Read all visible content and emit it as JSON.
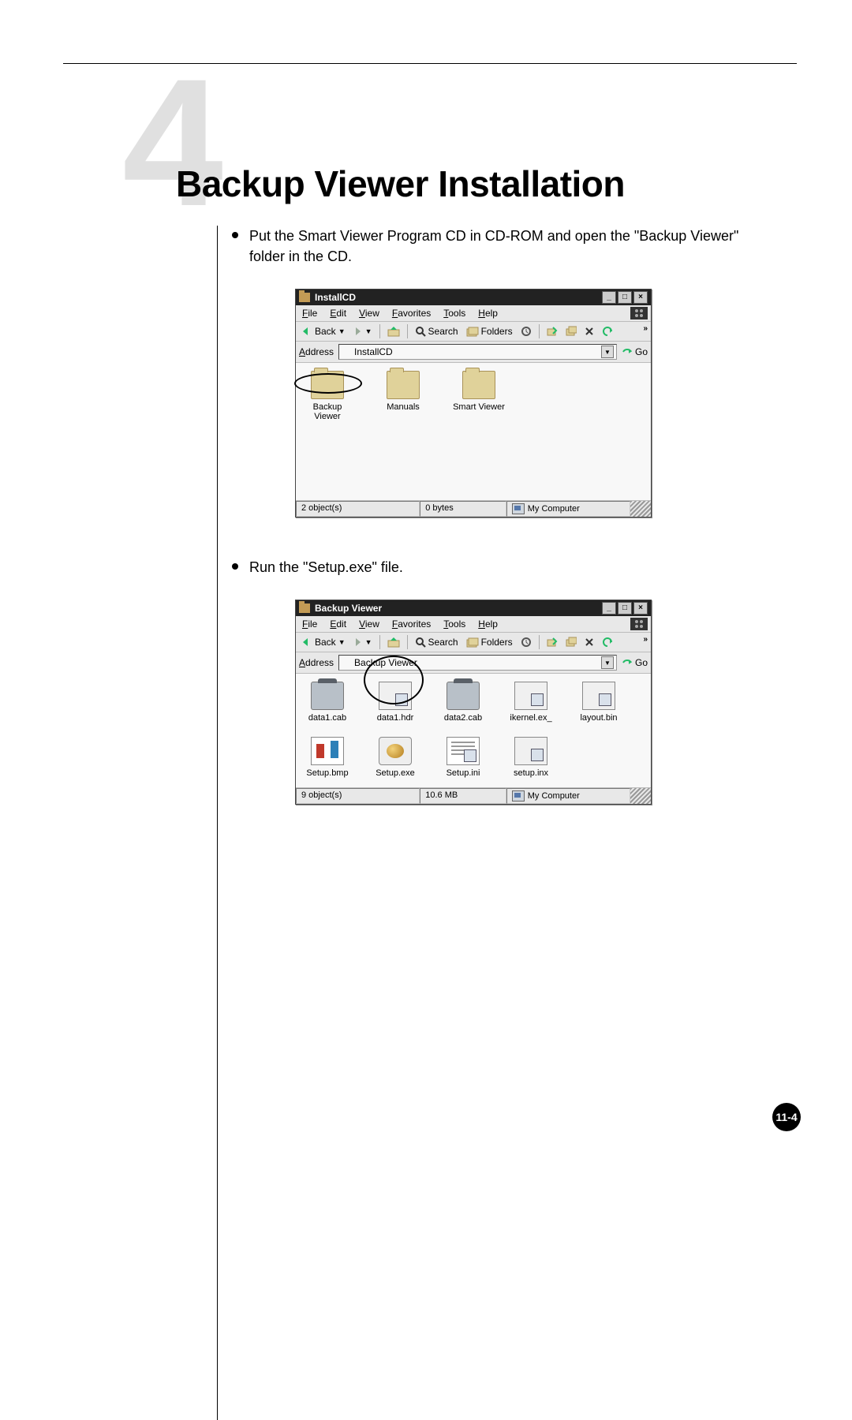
{
  "chapter_number": "4",
  "page_title": "Backup Viewer Installation",
  "bullets": {
    "b1": "Put the Smart Viewer Program CD in CD-ROM and open the \"Backup Viewer\" folder in the CD.",
    "b2": "Run the \"Setup.exe\" file."
  },
  "explorer_common": {
    "menus": {
      "file": "File",
      "edit": "Edit",
      "view": "View",
      "favorites": "Favorites",
      "tools": "Tools",
      "help": "Help"
    },
    "toolbar": {
      "back": "Back",
      "search": "Search",
      "folders": "Folders"
    },
    "address_label": "Address",
    "go": "Go",
    "location": "My Computer",
    "overflow": "»"
  },
  "win1": {
    "title": "InstallCD",
    "address": "InstallCD",
    "files": [
      {
        "name": "Backup Viewer",
        "type": "folder"
      },
      {
        "name": "Manuals",
        "type": "folder"
      },
      {
        "name": "Smart Viewer",
        "type": "folder"
      }
    ],
    "status_objects": "2 object(s)",
    "status_size": "0 bytes"
  },
  "win2": {
    "title": "Backup Viewer",
    "address": "Backup Viewer",
    "files": [
      {
        "name": "data1.cab",
        "type": "cab"
      },
      {
        "name": "data1.hdr",
        "type": "gen"
      },
      {
        "name": "data2.cab",
        "type": "cab"
      },
      {
        "name": "ikernel.ex_",
        "type": "gen"
      },
      {
        "name": "layout.bin",
        "type": "gen"
      },
      {
        "name": "Setup.bmp",
        "type": "bmp"
      },
      {
        "name": "Setup.exe",
        "type": "exe"
      },
      {
        "name": "Setup.ini",
        "type": "ini"
      },
      {
        "name": "setup.inx",
        "type": "gen"
      }
    ],
    "status_objects": "9 object(s)",
    "status_size": "10.6 MB"
  },
  "page_number": "11-4"
}
